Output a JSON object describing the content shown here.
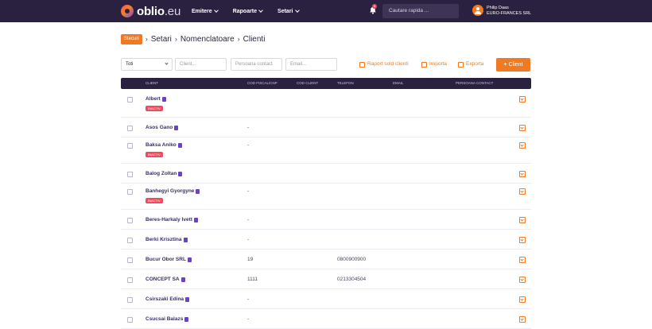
{
  "brand": {
    "name": "oblio",
    "tld": ".eu"
  },
  "nav": {
    "items": [
      "Emitere",
      "Rapoarte",
      "Setari"
    ]
  },
  "notifications": {
    "count": "0"
  },
  "search": {
    "placeholder": "Cautare rapida ..."
  },
  "user": {
    "name": "Philip Daas",
    "company": "EURO-FRANCES SRL"
  },
  "breadcrumb": {
    "badge": "Stecuri",
    "items": [
      "Setari",
      "Nomenclatoare",
      "Clienti"
    ]
  },
  "filters": {
    "type_value": "Toti",
    "client_placeholder": "Client...",
    "contact_placeholder": "Persoana contact",
    "email_placeholder": "Email..."
  },
  "actions": {
    "report": "Raport sold clienti",
    "import": "Importa",
    "export": "Exporta",
    "add": "Client"
  },
  "table": {
    "headers": [
      "Client",
      "Cod fiscal/CNP",
      "Cod client",
      "Telefon",
      "Email",
      "Persoana contact"
    ],
    "rows": [
      {
        "name": "Albert",
        "cif": "",
        "phone": "",
        "badge": "INACTIV"
      },
      {
        "name": "Asos Gano",
        "cif": "-",
        "phone": "",
        "badge": ""
      },
      {
        "name": "Baksa Aniko",
        "cif": "-",
        "phone": "",
        "badge": "INACTIV"
      },
      {
        "name": "Balog Zoltan",
        "cif": "",
        "phone": "",
        "badge": ""
      },
      {
        "name": "Banhegyi Gyorgyne",
        "cif": "-",
        "phone": "",
        "badge": "INACTIV"
      },
      {
        "name": "Beres-Harkaly Ivett",
        "cif": "-",
        "phone": "",
        "badge": ""
      },
      {
        "name": "Berki Krisztina",
        "cif": "-",
        "phone": "",
        "badge": ""
      },
      {
        "name": "Bucur Obor SRL",
        "cif": "19",
        "phone": "0800900900",
        "badge": ""
      },
      {
        "name": "CONCEPT SA",
        "cif": "1111",
        "phone": "0213304504",
        "badge": ""
      },
      {
        "name": "Csirszaki Edina",
        "cif": "-",
        "phone": "",
        "badge": ""
      },
      {
        "name": "Csucsai Balazs",
        "cif": "-",
        "phone": "",
        "badge": ""
      }
    ]
  },
  "colors": {
    "navbar": "#2a2140",
    "accent": "#f07a24",
    "inactive_badge": "#ef4b5f",
    "client_link": "#3a2e67"
  }
}
